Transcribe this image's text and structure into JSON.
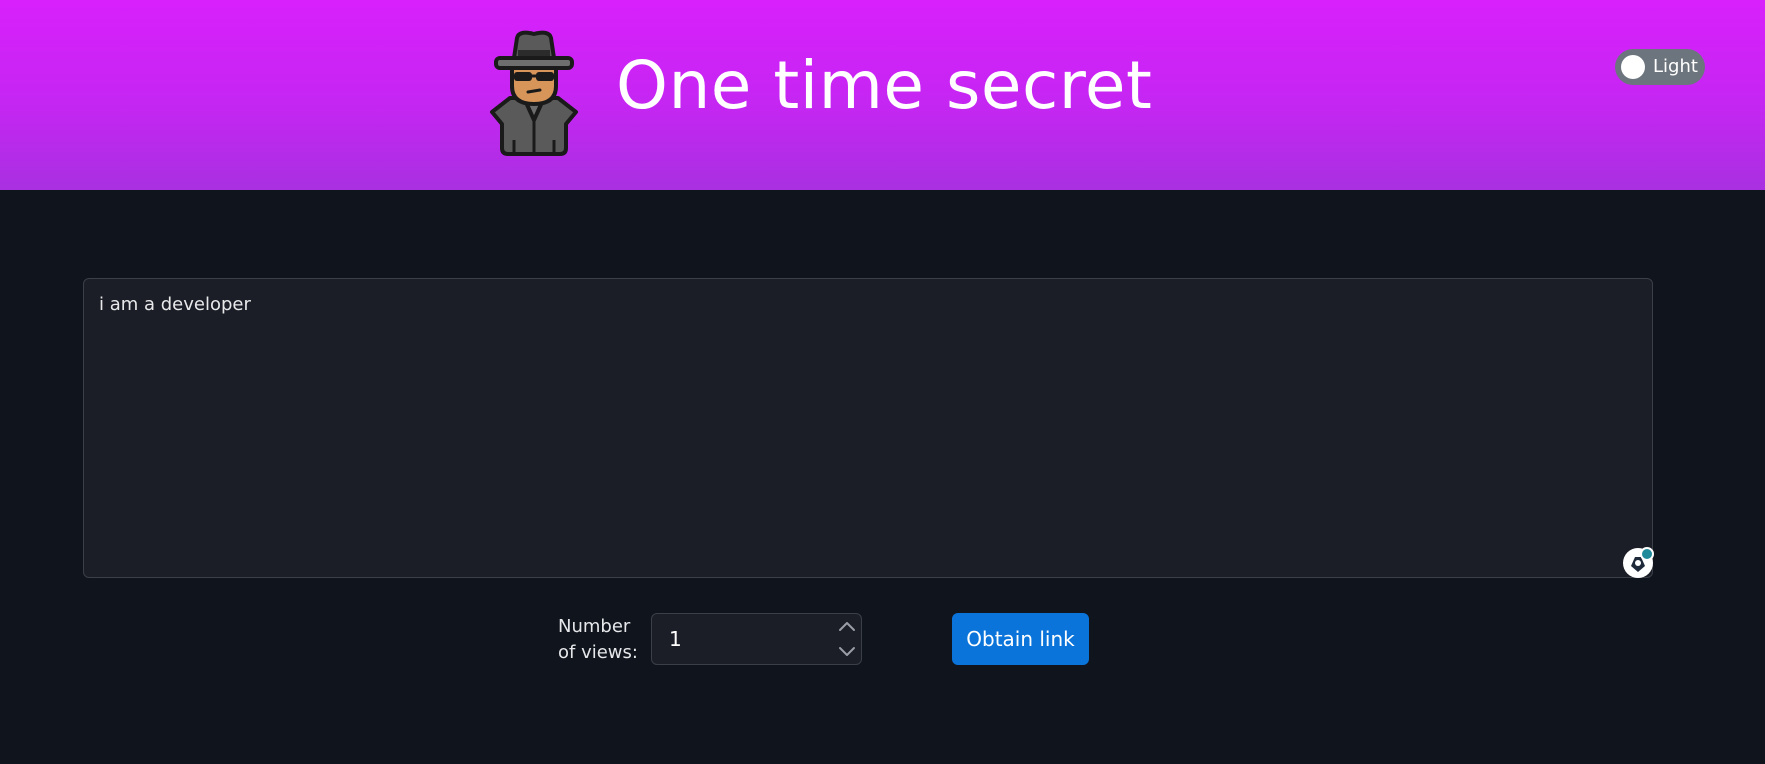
{
  "header": {
    "title": "One time secret",
    "theme_toggle": {
      "label": "Light",
      "state": "off"
    },
    "logo_icon": "spy-detective-icon"
  },
  "main": {
    "secret_text": "i am a developer",
    "assist_icon": "assistant-extension-icon",
    "views": {
      "label": "Number of views:",
      "value": "1",
      "spin_up_icon": "chevron-up-icon",
      "spin_down_icon": "chevron-down-icon"
    },
    "obtain_button_label": "Obtain link"
  },
  "colors": {
    "header_gradient_top": "#d820fc",
    "header_gradient_bottom": "#a930e1",
    "background": "#10141c",
    "panel": "#1b1e26",
    "button_primary": "#0a74da",
    "toggle_bg": "#6c757d"
  }
}
